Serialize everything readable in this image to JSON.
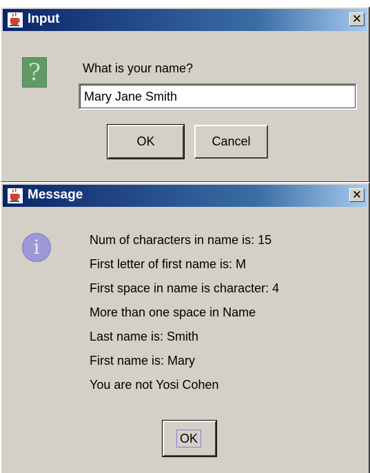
{
  "input_dialog": {
    "title": "Input",
    "close_glyph": "✕",
    "icon": "question-icon",
    "prompt": "What is your name?",
    "field_value": "Mary Jane Smith",
    "ok_label": "OK",
    "cancel_label": "Cancel"
  },
  "message_dialog": {
    "title": "Message",
    "close_glyph": "✕",
    "icon": "information-icon",
    "lines": [
      "Num of characters in name is: 15",
      "First letter of first name is: M",
      "First space in name is character: 4",
      "More than one space in Name",
      "Last name is:  Smith",
      "First name is: Mary",
      "You are not Yosi Cohen"
    ],
    "ok_label": "OK"
  },
  "colors": {
    "titlebar_start": "#0a246a",
    "titlebar_end": "#a6caf0",
    "window_bg": "#d4d0c8",
    "question_icon": "#5f9a66",
    "info_icon": "#9b9ad6"
  }
}
